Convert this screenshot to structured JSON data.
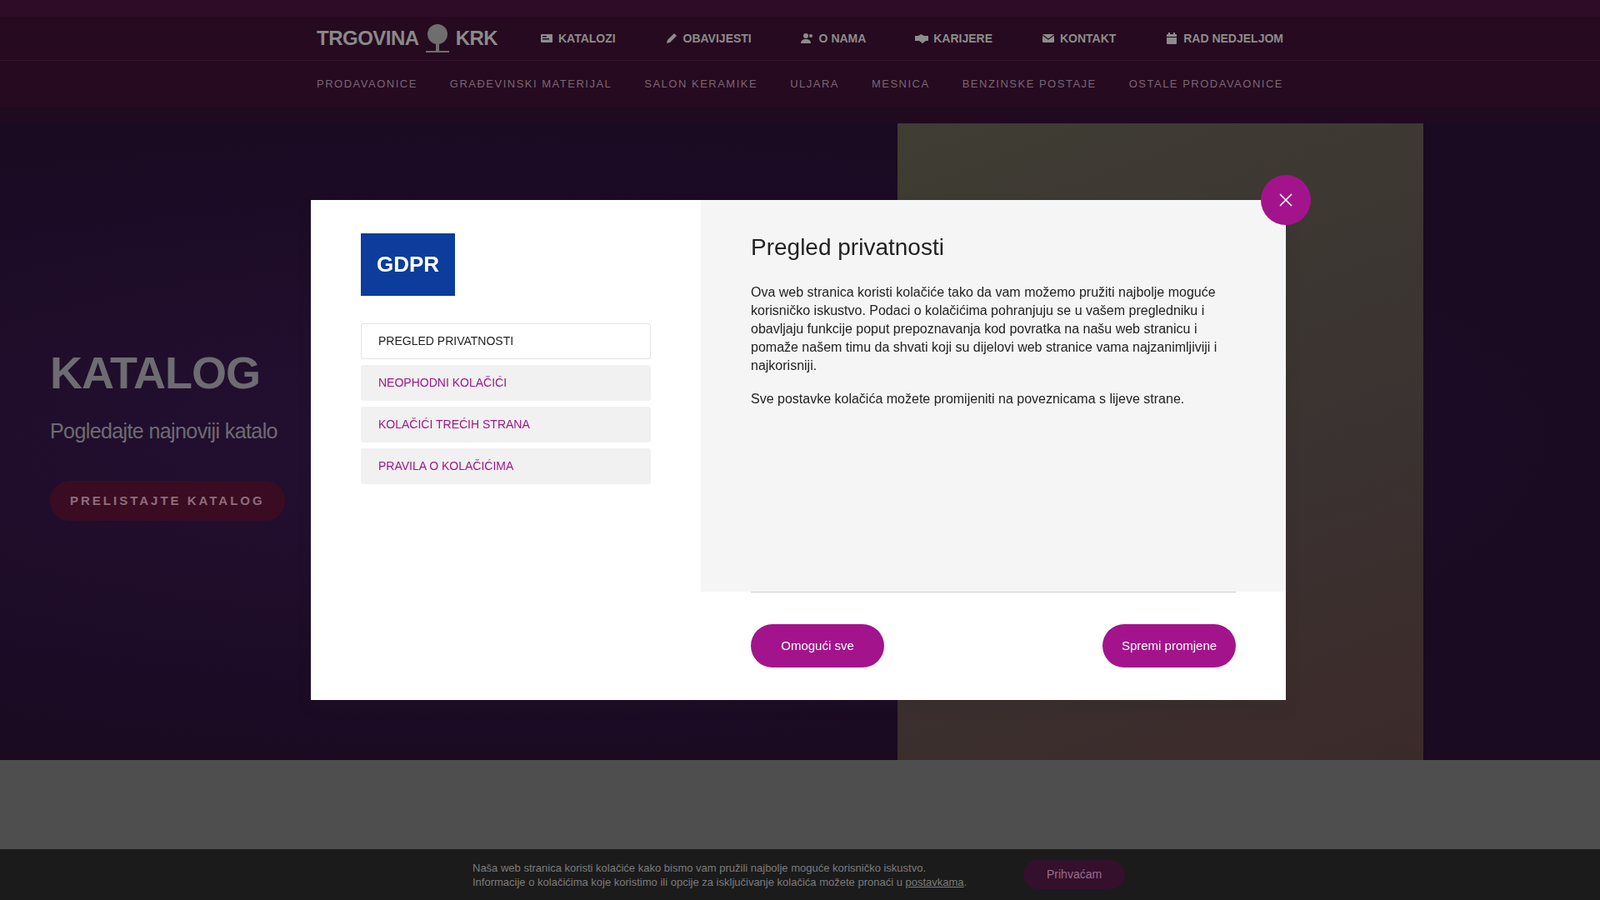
{
  "header": {
    "logo": {
      "left": "TRGOVINA",
      "right": "KRK"
    },
    "top_nav": [
      "KATALOZI",
      "OBAVIJESTI",
      "O NAMA",
      "KARIJERE",
      "KONTAKT",
      "RAD NEDJELJOM"
    ],
    "sub_nav": [
      "PRODAVAONICE",
      "GRAĐEVINSKI MATERIJAL",
      "SALON KERAMIKE",
      "ULJARA",
      "MESNICA",
      "BENZINSKE POSTAJE",
      "OSTALE PRODAVAONICE"
    ]
  },
  "hero": {
    "title": "KATALOG",
    "subtitle": "Pogledajte najnoviji katalo",
    "button": "PRELISTAJTE KATALOG"
  },
  "modal": {
    "badge": "GDPR",
    "menu": [
      {
        "label": "PREGLED PRIVATNOSTI",
        "selected": true
      },
      {
        "label": "NEOPHODNI KOLAČIĆI",
        "selected": false
      },
      {
        "label": "KOLAČIĆI TREĆIH STRANA",
        "selected": false
      },
      {
        "label": "PRAVILA O KOLAČIĆIMA",
        "selected": false
      }
    ],
    "title": "Pregled privatnosti",
    "paragraphs": [
      "Ova web stranica koristi kolačiće tako da vam možemo pružiti najbolje moguće korisničko iskustvo. Podaci o kolačićima pohranjuju se u vašem pregledniku i obavljaju funkcije poput prepoznavanja kod povratka na našu web stranicu i pomaže našem timu da shvati koji su dijelovi web stranice vama najzanimljiviji i najkorisniji.",
      "Sve postavke kolačića možete promijeniti na poveznicama s lijeve strane."
    ],
    "buttons": [
      "Omogući sve",
      "Spremi promjene"
    ]
  },
  "cookie_bar": {
    "line1": "Naša web stranica koristi kolačiće kako bismo vam pružili najbolje moguće korisničko iskustvo.",
    "line2": "Informacije o kolačićima koje koristimo ili opcije za isključivanje kolačića možete pronaći u ",
    "link": "postavkama",
    "end": ".",
    "button": "Prihvaćam"
  }
}
